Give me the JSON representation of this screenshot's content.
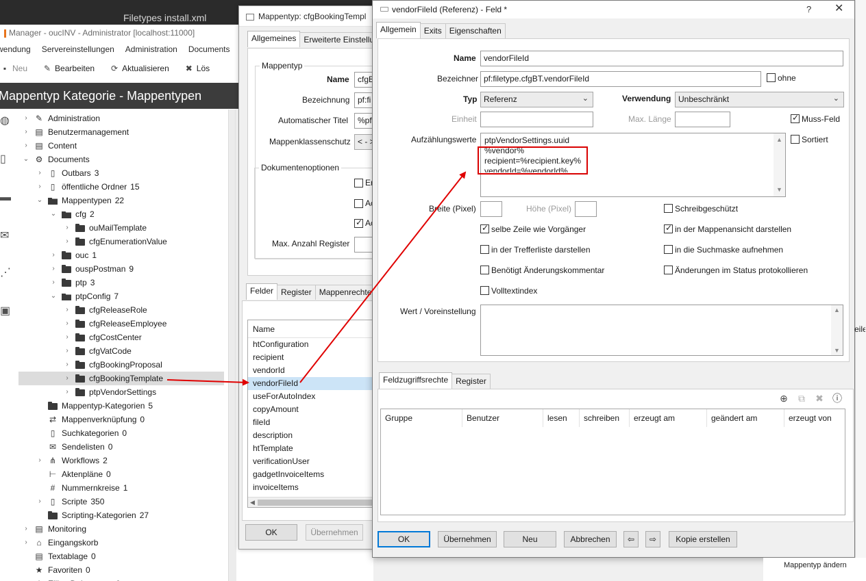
{
  "app": {
    "editor_tab": "Filetypes install.xml",
    "title": "Manager - oucINV - Administrator [localhost:11000]",
    "menu": [
      "wendung",
      "Servereinstellungen",
      "Administration",
      "Documents"
    ],
    "toolbar": {
      "new": "Neu",
      "edit": "Bearbeiten",
      "refresh": "Aktualisieren",
      "delete": "Lös"
    },
    "section_title": "Mappentyp Kategorie - Mappentypen",
    "tree": [
      {
        "label": "Administration",
        "count": "",
        "level": 0,
        "icon": "wrench-icon"
      },
      {
        "label": "Benutzermanagement",
        "count": "",
        "level": 0,
        "icon": "users-icon"
      },
      {
        "label": "Content",
        "count": "",
        "level": 0,
        "icon": "content-icon"
      },
      {
        "label": "Documents",
        "count": "",
        "level": 0,
        "icon": "gear-icon"
      },
      {
        "label": "Outbars",
        "count": "3",
        "level": 1,
        "icon": "outbar-icon"
      },
      {
        "label": "öffentliche Ordner",
        "count": "15",
        "level": 1,
        "icon": "public-folder-icon"
      },
      {
        "label": "Mappentypen",
        "count": "22",
        "level": 1,
        "icon": "folder-open-icon"
      },
      {
        "label": "cfg",
        "count": "2",
        "level": 2,
        "icon": "folder-open-icon"
      },
      {
        "label": "ouMailTemplate",
        "count": "",
        "level": 3,
        "icon": "folder-icon"
      },
      {
        "label": "cfgEnumerationValue",
        "count": "",
        "level": 3,
        "icon": "folder-icon"
      },
      {
        "label": "ouc",
        "count": "1",
        "level": 2,
        "icon": "folder-icon"
      },
      {
        "label": "ouspPostman",
        "count": "9",
        "level": 2,
        "icon": "folder-icon"
      },
      {
        "label": "ptp",
        "count": "3",
        "level": 2,
        "icon": "folder-icon"
      },
      {
        "label": "ptpConfig",
        "count": "7",
        "level": 2,
        "icon": "folder-open-icon"
      },
      {
        "label": "cfgReleaseRole",
        "count": "",
        "level": 3,
        "icon": "folder-icon"
      },
      {
        "label": "cfgReleaseEmployee",
        "count": "",
        "level": 3,
        "icon": "folder-icon"
      },
      {
        "label": "cfgCostCenter",
        "count": "",
        "level": 3,
        "icon": "folder-icon"
      },
      {
        "label": "cfgVatCode",
        "count": "",
        "level": 3,
        "icon": "folder-icon"
      },
      {
        "label": "cfgBookingProposal",
        "count": "",
        "level": 3,
        "icon": "folder-icon"
      },
      {
        "label": "cfgBookingTemplate",
        "count": "",
        "level": 3,
        "icon": "folder-icon"
      },
      {
        "label": "ptpVendorSettings",
        "count": "",
        "level": 3,
        "icon": "folder-icon"
      },
      {
        "label": "Mappentyp-Kategorien",
        "count": "5",
        "level": 1,
        "icon": "folder-icon"
      },
      {
        "label": "Mappenverknüpfung",
        "count": "0",
        "level": 1,
        "icon": "link-icon"
      },
      {
        "label": "Suchkategorien",
        "count": "0",
        "level": 1,
        "icon": "search-category-icon"
      },
      {
        "label": "Sendelisten",
        "count": "0",
        "level": 1,
        "icon": "mail-icon"
      },
      {
        "label": "Workflows",
        "count": "2",
        "level": 1,
        "icon": "workflow-icon"
      },
      {
        "label": "Aktenpläne",
        "count": "0",
        "level": 1,
        "icon": "plan-icon"
      },
      {
        "label": "Nummernkreise",
        "count": "1",
        "level": 1,
        "icon": "hash-icon"
      },
      {
        "label": "Scripte",
        "count": "350",
        "level": 1,
        "icon": "script-icon"
      },
      {
        "label": "Scripting-Kategorien",
        "count": "27",
        "level": 1,
        "icon": "folder-icon"
      },
      {
        "label": "Monitoring",
        "count": "",
        "level": 0,
        "icon": "monitor-icon"
      },
      {
        "label": "Eingangskorb",
        "count": "",
        "level": 0,
        "icon": "inbox-icon"
      },
      {
        "label": "Textablage",
        "count": "0",
        "level": 0,
        "icon": "text-icon"
      },
      {
        "label": "Favoriten",
        "count": "0",
        "level": 0,
        "icon": "star-icon"
      },
      {
        "label": "Eilige Dokumente",
        "count": "0",
        "level": 0,
        "icon": "urgent-icon"
      }
    ]
  },
  "mappentyp_dialog": {
    "title": "Mappentyp:  cfgBookingTempl",
    "tabs": [
      "Allgemeines",
      "Erweiterte Einstellu"
    ],
    "group_title": "Mappentyp",
    "labels": {
      "name": "Name",
      "bezeichnung": "Bezeichnung",
      "auto_title": "Automatischer Titel",
      "protection": "Mappenklassenschutz"
    },
    "values": {
      "name": "cfgB",
      "bezeichnung": "pf:fi",
      "auto_title": "%pf",
      "protection": "< - >"
    },
    "doc_group_title": "Dokumentenoptionen",
    "doc_options": [
      "Er",
      "Ac",
      "Ac"
    ],
    "max_register_label": "Max. Anzahl  Register",
    "lower_tabs": [
      "Felder",
      "Register",
      "Mappenrechte"
    ],
    "fields_header": "Name",
    "fields": [
      "htConfiguration",
      "recipient",
      "vendorId",
      "vendorFileId",
      "useForAutoIndex",
      "copyAmount",
      "fileId",
      "description",
      "htTemplate",
      "verificationUser",
      "gadgetInvoiceItems",
      "invoiceItems"
    ],
    "selected_field": "vendorFileId",
    "ok": "OK",
    "apply": "Übernehmen"
  },
  "feld_dialog": {
    "title": "vendorFileId (Referenz) - Feld *",
    "help": "?",
    "close": "✕",
    "tabs": [
      "Allgemein",
      "Exits",
      "Eigenschaften"
    ],
    "labels": {
      "name": "Name",
      "bezeichner": "Bezeichner",
      "typ": "Typ",
      "verwendung": "Verwendung",
      "einheit": "Einheit",
      "max_laenge": "Max. Länge",
      "aufzaehlung": "Aufzählungswerte",
      "breite": "Breite (Pixel)",
      "hoehe": "Höhe (Pixel)",
      "wert": "Wert / Voreinstellung"
    },
    "values": {
      "name": "vendorFileId",
      "bezeichner": "pf:filetype.cfgBT.vendorFileId",
      "typ": "Referenz",
      "verwendung": "Unbeschränkt",
      "einheit": "",
      "max_laenge": "",
      "enum_values": [
        "ptpVendorSettings.uuid",
        "%vendor%",
        "recipient=%recipient.key%",
        "vendorId=%vendorId%"
      ],
      "breite": "",
      "hoehe": "",
      "wert": ""
    },
    "checkboxes": {
      "ohne": {
        "label": "ohne",
        "checked": false
      },
      "muss_feld": {
        "label": "Muss-Feld",
        "checked": true
      },
      "sortiert": {
        "label": "Sortiert",
        "checked": false
      },
      "schreibgeschuetzt": {
        "label": "Schreibgeschützt",
        "checked": false
      },
      "selbe_zeile": {
        "label": "selbe Zeile wie Vorgänger",
        "checked": true
      },
      "mappenansicht": {
        "label": "in der Mappenansicht darstellen",
        "checked": true
      },
      "trefferliste": {
        "label": "in der Trefferliste darstellen",
        "checked": false
      },
      "suchmaske": {
        "label": "in die Suchmaske aufnehmen",
        "checked": false
      },
      "aenderungskommentar": {
        "label": "Benötigt Änderungskommentar",
        "checked": false
      },
      "status_protokoll": {
        "label": "Änderungen im Status protokollieren",
        "checked": false
      },
      "volltextindex": {
        "label": "Volltextindex",
        "checked": false
      }
    },
    "rights_tabs": [
      "Feldzugriffsrechte",
      "Register"
    ],
    "rights_columns": [
      "Gruppe",
      "Benutzer",
      "lesen",
      "schreiben",
      "erzeugt am",
      "geändert am",
      "erzeugt von"
    ],
    "buttons": {
      "ok": "OK",
      "apply": "Übernehmen",
      "new": "Neu",
      "cancel": "Abbrechen",
      "copy": "Kopie erstellen"
    }
  },
  "right_fragments": {
    "eile": "eile",
    "mappentyp_aendern": "Mappentyp ändern"
  },
  "colors": {
    "highlight": "#d90000",
    "arrow": "#e00000",
    "selection": "#cce4f7",
    "default_button_border": "#0078d7"
  }
}
